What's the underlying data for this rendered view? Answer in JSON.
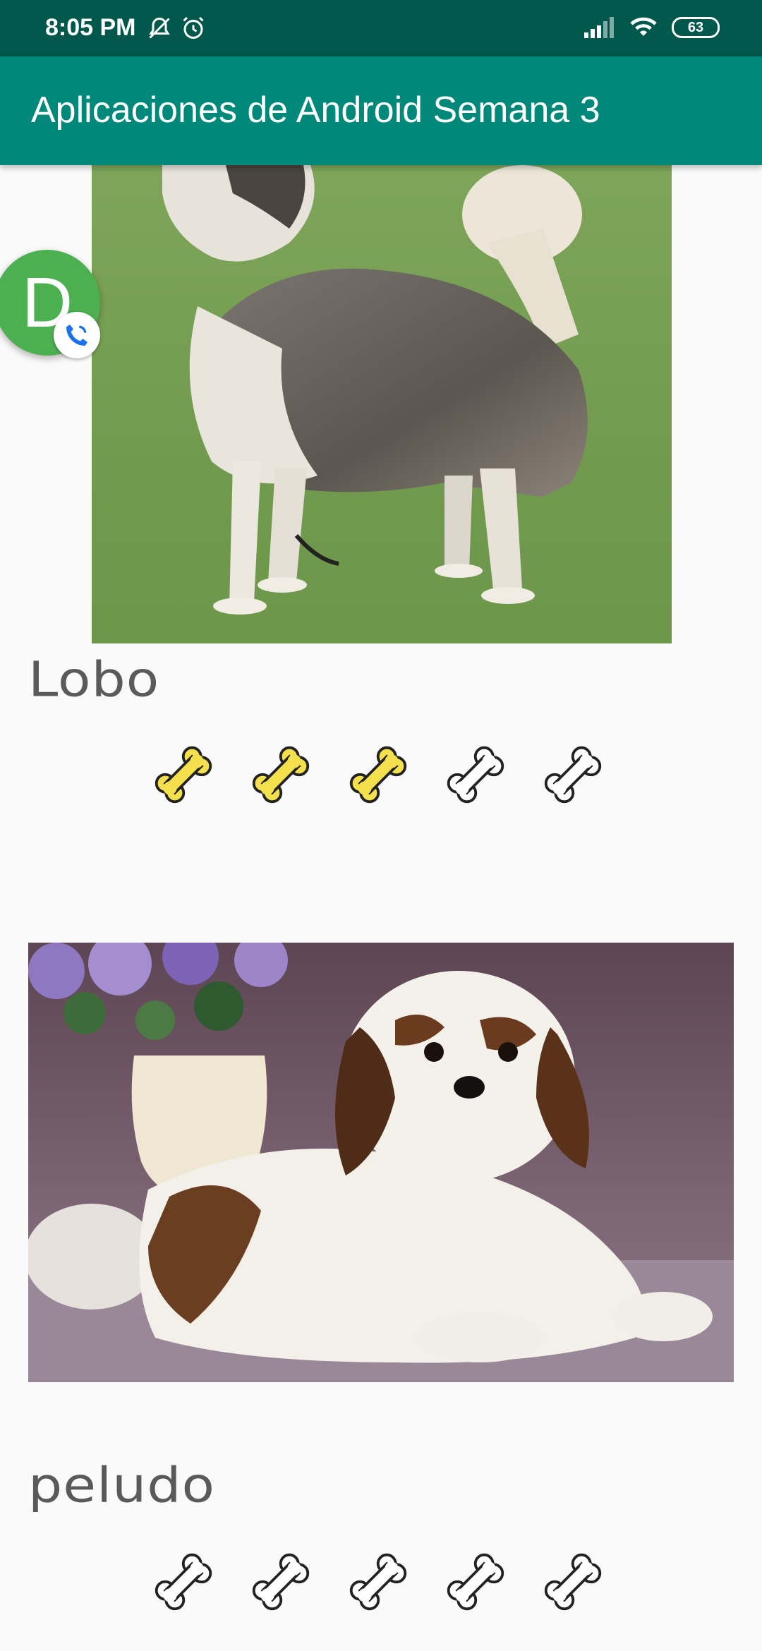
{
  "status_bar": {
    "time": "8:05 PM",
    "battery": "63",
    "icons": [
      "mute-bell-icon",
      "alarm-icon",
      "signal-icon",
      "wifi-icon",
      "battery-icon"
    ]
  },
  "app_bar": {
    "title": "Aplicaciones de Android Semana 3",
    "color": "#00897b"
  },
  "chat_head": {
    "initial": "D",
    "color": "#4caf50"
  },
  "pets": [
    {
      "name": "Lobo",
      "rating": 3,
      "max_rating": 5,
      "photo": "husky-dog-photo"
    },
    {
      "name": "peludo",
      "rating": 0,
      "max_rating": 5,
      "photo": "shih-tzu-dog-photo"
    }
  ],
  "colors": {
    "bone_filled": "#f4e04d",
    "bone_empty": "#ffffff",
    "status_bar": "#00574b"
  }
}
